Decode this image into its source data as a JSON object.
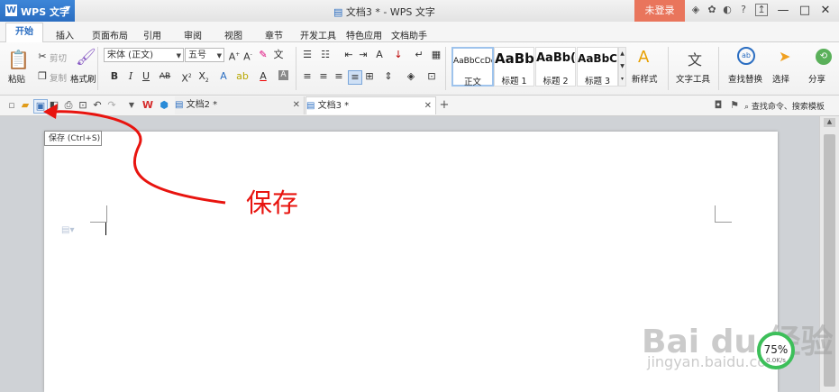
{
  "title_bar": {
    "app_name": "WPS 文字",
    "app_logo": "W",
    "doc_title": "文档3 * - WPS 文字",
    "login_label": "未登录",
    "minimize": "—",
    "maximize": "□",
    "close": "✕"
  },
  "menu_tabs": [
    "开始",
    "插入",
    "页面布局",
    "引用",
    "审阅",
    "视图",
    "章节",
    "开发工具",
    "特色应用",
    "文档助手"
  ],
  "ribbon": {
    "paste_label": "粘贴",
    "cut_label": "剪切",
    "copy_label": "复制",
    "format_painter_label": "格式刷",
    "font_name": "宋体 (正文)",
    "font_size": "五号",
    "styles": [
      {
        "sample": "AaBbCcDd",
        "name": "正文"
      },
      {
        "sample": "AaBb",
        "name": "标题 1"
      },
      {
        "sample": "AaBb(",
        "name": "标题 2"
      },
      {
        "sample": "AaBbC",
        "name": "标题 3"
      }
    ],
    "new_style_label": "新样式",
    "text_tools_label": "文字工具",
    "find_replace_label": "查找替换",
    "select_label": "选择",
    "share_label": "分享"
  },
  "doc_tabs": {
    "tab1": "文档2 *",
    "tab2": "文档3 *",
    "search_label": "查找命令、搜索模板"
  },
  "tooltip": "保存 (Ctrl+S)",
  "callout": "保存",
  "watermark": {
    "logo": "Bai du 经验",
    "url": "jingyan.baidu.com"
  },
  "zoom": {
    "percent": "75%",
    "unit": "0.0K/s"
  },
  "colors": {
    "accent": "#2a6dc1",
    "login": "#e9755c",
    "callout": "#e8140f"
  }
}
